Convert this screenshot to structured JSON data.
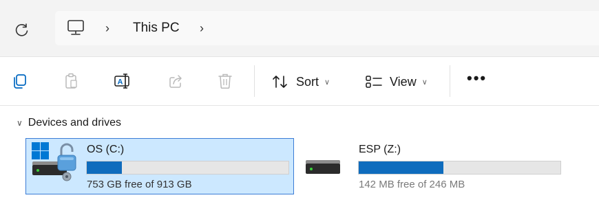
{
  "address_bar": {
    "breadcrumb": [
      "This PC"
    ]
  },
  "toolbar": {
    "sort_label": "Sort",
    "view_label": "View",
    "more_label": "•••"
  },
  "content": {
    "group_title": "Devices and drives",
    "drives": [
      {
        "name": "OS (C:)",
        "free_text": "753 GB free of 913 GB",
        "used_fraction": 0.175,
        "selected": true
      },
      {
        "name": "ESP (Z:)",
        "free_text": "142 MB free of 246 MB",
        "used_fraction": 0.42,
        "selected": false
      }
    ]
  },
  "colors": {
    "accent": "#0f6cbd",
    "selection_bg": "#cce8ff",
    "selection_border": "#3a7bd5",
    "icon_blue": "#0078d4"
  },
  "icons": [
    "refresh-icon",
    "computer-icon",
    "copy-icon",
    "paste-icon",
    "rename-icon",
    "share-icon",
    "delete-icon",
    "sort-icon",
    "view-icon",
    "windows-logo-icon",
    "lock-icon",
    "drive-icon"
  ]
}
